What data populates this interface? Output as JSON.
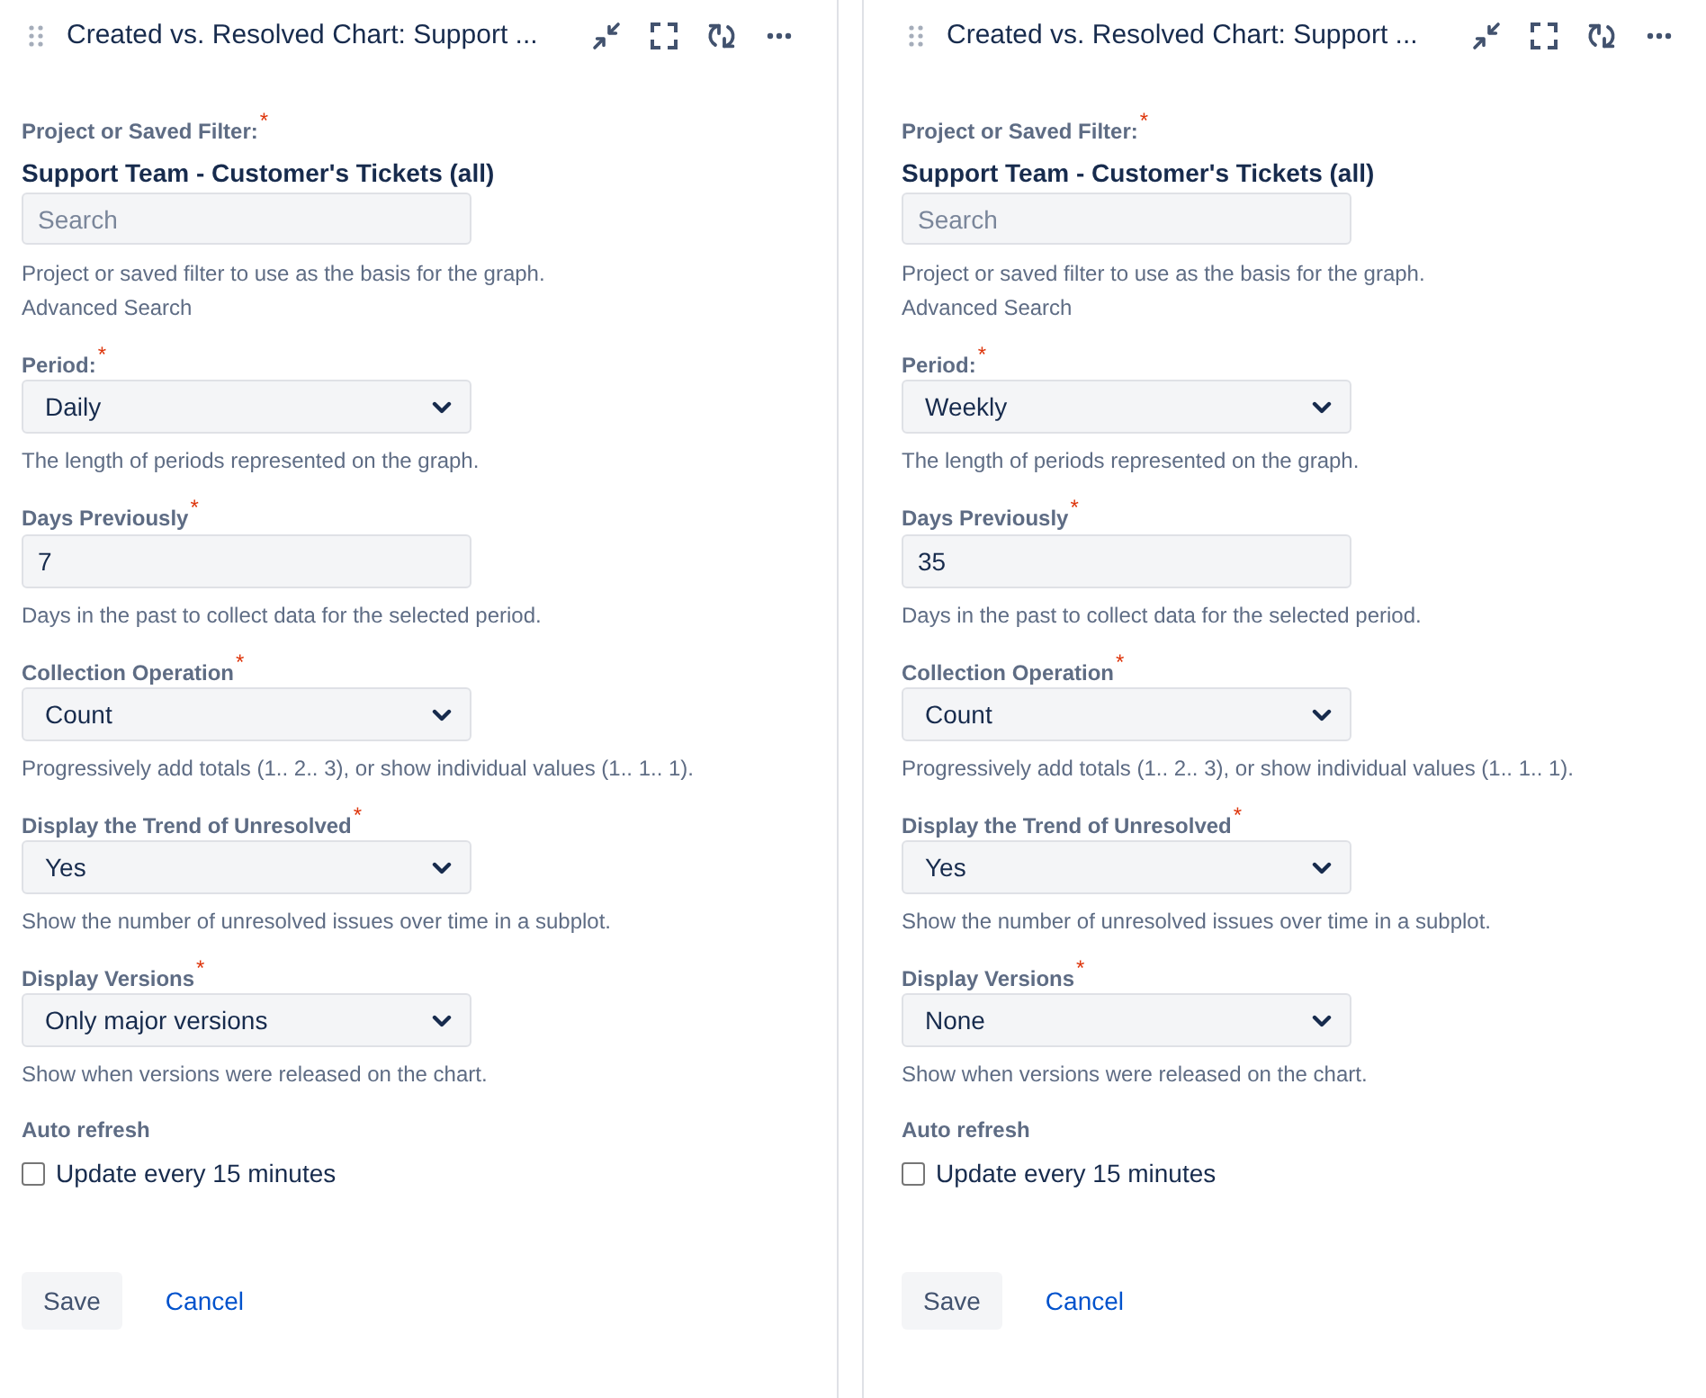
{
  "panels": [
    {
      "title": "Created vs. Resolved Chart: Support ...",
      "filter": {
        "label": "Project or Saved Filter:",
        "required_mark": "*",
        "value": "Support Team - Customer's Tickets (all)",
        "search": {
          "placeholder": "Search"
        },
        "help": "Project or saved filter to use as the basis for the graph.",
        "link": "Advanced Search"
      },
      "fields": [
        {
          "kind": "select",
          "label": "Period:",
          "required_mark": "*",
          "value": "Daily",
          "help": "The length of periods represented on the graph."
        },
        {
          "kind": "text",
          "label": "Days Previously",
          "required_mark": "*",
          "value": "7",
          "help": "Days in the past to collect data for the selected period."
        },
        {
          "kind": "select",
          "label": "Collection Operation",
          "required_mark": "*",
          "value": "Count",
          "help": "Progressively add totals (1.. 2.. 3), or show individual values (1.. 1.. 1)."
        },
        {
          "kind": "select",
          "label": "Display the Trend of Unresolved",
          "required_mark": "*",
          "value": "Yes",
          "help": "Show the number of unresolved issues over time in a subplot."
        },
        {
          "kind": "select",
          "label": "Display Versions",
          "required_mark": "*",
          "value": "Only major versions",
          "help": "Show when versions were released on the chart."
        }
      ],
      "auto_refresh": {
        "label": "Auto refresh",
        "option": {
          "label": "Update every 15 minutes",
          "checked": false
        }
      },
      "buttons": [
        {
          "kind": "button",
          "label": "Save"
        },
        {
          "kind": "link",
          "label": "Cancel"
        }
      ]
    },
    {
      "title": "Created vs. Resolved Chart: Support ...",
      "filter": {
        "label": "Project or Saved Filter:",
        "required_mark": "*",
        "value": "Support Team - Customer's Tickets (all)",
        "search": {
          "placeholder": "Search"
        },
        "help": "Project or saved filter to use as the basis for the graph.",
        "link": "Advanced Search"
      },
      "fields": [
        {
          "kind": "select",
          "label": "Period:",
          "required_mark": "*",
          "value": "Weekly",
          "help": "The length of periods represented on the graph."
        },
        {
          "kind": "text",
          "label": "Days Previously",
          "required_mark": "*",
          "value": "35",
          "help": "Days in the past to collect data for the selected period."
        },
        {
          "kind": "select",
          "label": "Collection Operation",
          "required_mark": "*",
          "value": "Count",
          "help": "Progressively add totals (1.. 2.. 3), or show individual values (1.. 1.. 1)."
        },
        {
          "kind": "select",
          "label": "Display the Trend of Unresolved",
          "required_mark": "*",
          "value": "Yes",
          "help": "Show the number of unresolved issues over time in a subplot."
        },
        {
          "kind": "select",
          "label": "Display Versions",
          "required_mark": "*",
          "value": "None",
          "help": "Show when versions were released on the chart."
        }
      ],
      "auto_refresh": {
        "label": "Auto refresh",
        "option": {
          "label": "Update every 15 minutes",
          "checked": false
        }
      },
      "buttons": [
        {
          "kind": "button",
          "label": "Save"
        },
        {
          "kind": "link",
          "label": "Cancel"
        }
      ]
    }
  ]
}
